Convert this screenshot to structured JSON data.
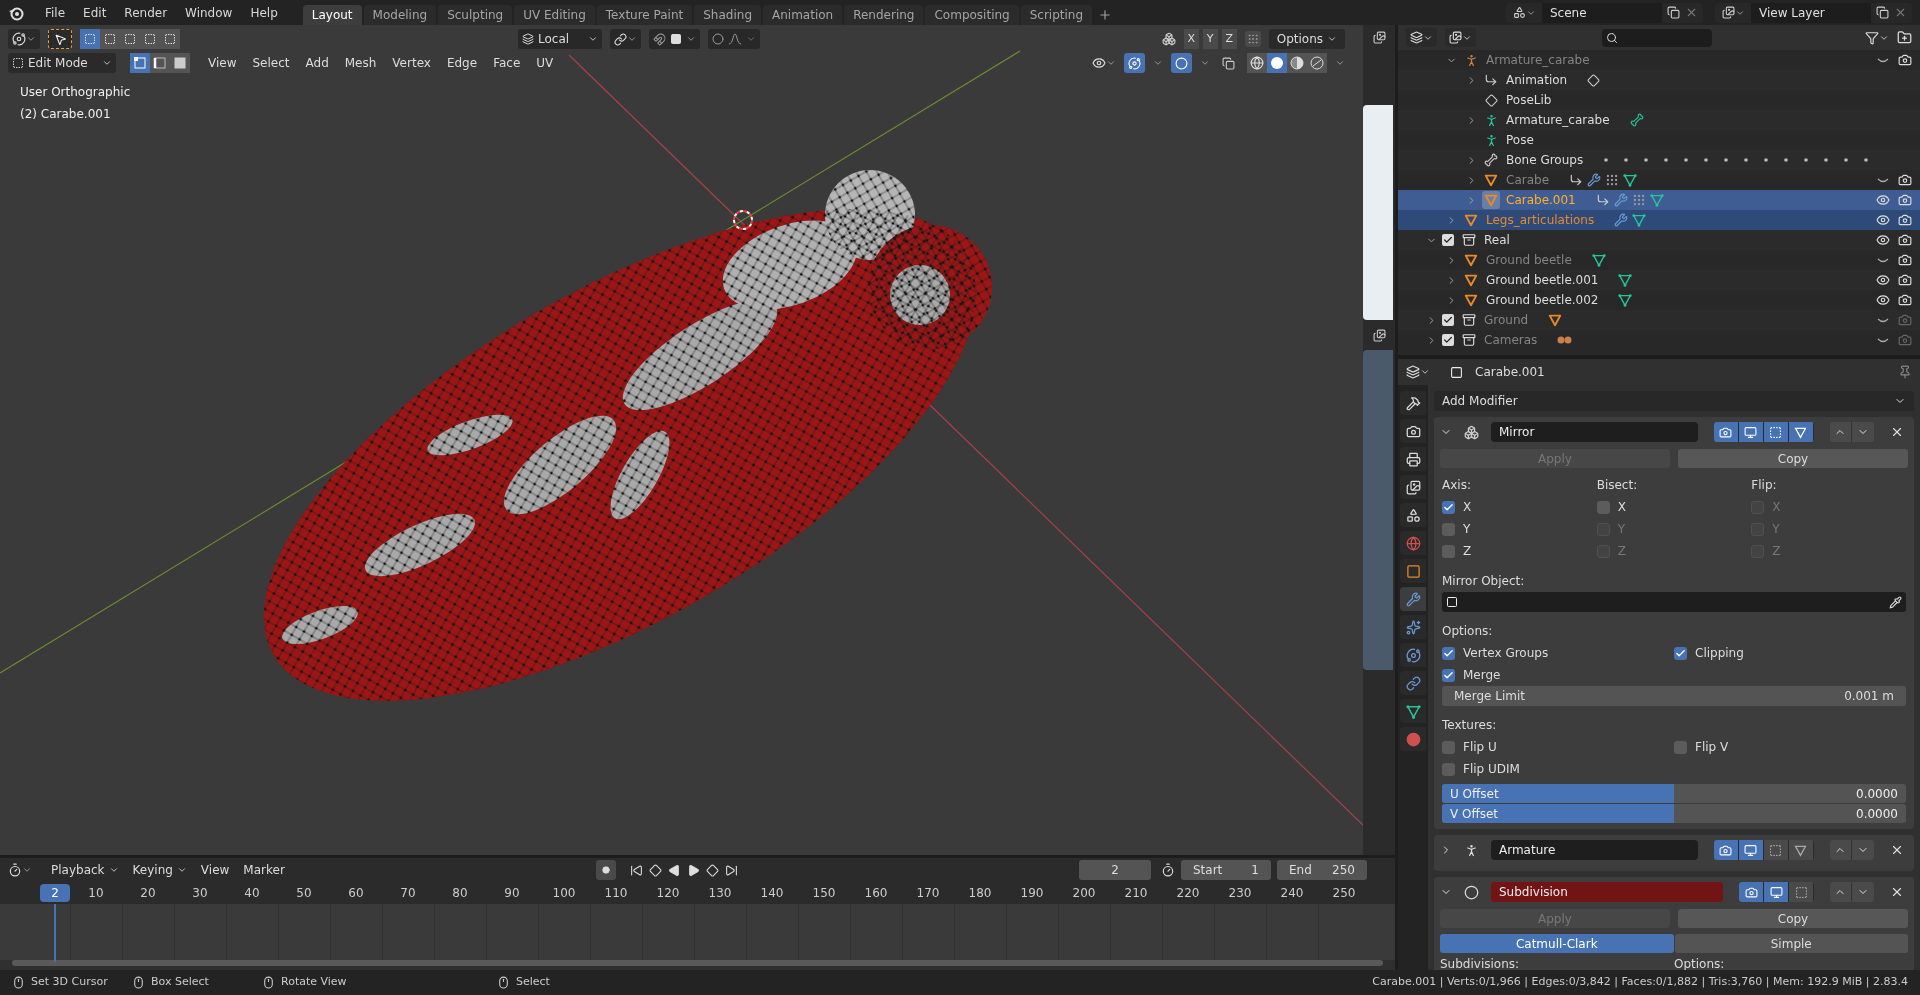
{
  "menu": [
    "File",
    "Edit",
    "Render",
    "Window",
    "Help"
  ],
  "workspaces": [
    {
      "label": "Layout",
      "selected": true
    },
    {
      "label": "Modeling",
      "selected": false
    },
    {
      "label": "Sculpting",
      "selected": false
    },
    {
      "label": "UV Editing",
      "selected": false
    },
    {
      "label": "Texture Paint",
      "selected": false
    },
    {
      "label": "Shading",
      "selected": false
    },
    {
      "label": "Animation",
      "selected": false
    },
    {
      "label": "Rendering",
      "selected": false
    },
    {
      "label": "Compositing",
      "selected": false
    },
    {
      "label": "Scripting",
      "selected": false
    }
  ],
  "scene": "Scene",
  "view_layer": "View Layer",
  "viewport": {
    "selection_ops": [
      {
        "selected": true
      },
      {
        "selected": false
      },
      {
        "selected": false
      },
      {
        "selected": false
      },
      {
        "selected": false
      }
    ],
    "orientation": "Local",
    "axis_toggles": [
      {
        "label": "X",
        "on": false
      },
      {
        "label": "Y",
        "on": false
      },
      {
        "label": "Z",
        "on": false
      }
    ],
    "options": "Options",
    "mode": "Edit Mode",
    "select_modes": [
      {
        "kind": "vertex",
        "selected": true
      },
      {
        "kind": "edge",
        "selected": false
      },
      {
        "kind": "face",
        "selected": false
      }
    ],
    "menus": [
      "View",
      "Select",
      "Add",
      "Mesh",
      "Vertex",
      "Edge",
      "Face",
      "UV"
    ],
    "shading": [
      {
        "kind": "wireframe",
        "selected": false
      },
      {
        "kind": "solid",
        "selected": true
      },
      {
        "kind": "material",
        "selected": false
      },
      {
        "kind": "rendered",
        "selected": false
      }
    ],
    "view_name": "User Orthographic",
    "object_label": "(2) Carabe.001"
  },
  "outliner": {
    "continued_items": [
      {
        "name": "Armature_carabe",
        "kind": "armature",
        "expanded": true,
        "dimmed": true,
        "selected": false,
        "active": false,
        "visible": false,
        "renderable": true,
        "children": [
          {
            "name": "Animation",
            "kind": "action",
            "expanded": false,
            "dimmed": false,
            "selected": false,
            "active": false,
            "badges": [
              {
                "kind": "poselib"
              }
            ]
          },
          {
            "name": "PoseLib",
            "kind": "poselib",
            "dimmed": false,
            "selected": false,
            "active": false
          },
          {
            "name": "Armature_carabe",
            "kind": "armature_data",
            "expanded": false,
            "dimmed": false,
            "selected": false,
            "active": false,
            "badges": [
              {
                "kind": "bone"
              }
            ]
          },
          {
            "name": "Pose",
            "kind": "pose",
            "dimmed": false,
            "selected": false,
            "active": false
          },
          {
            "name": "Bone Groups",
            "kind": "bone_groups",
            "expanded": false,
            "dimmed": false,
            "selected": false,
            "active": false,
            "badges": [
              {
                "kind": "dots"
              }
            ]
          },
          {
            "name": "Carabe",
            "kind": "mesh_object",
            "expanded": false,
            "dimmed": true,
            "selected": false,
            "active": false,
            "visible": false,
            "renderable": true,
            "badges": [
              {
                "kind": "action"
              },
              {
                "kind": "modifier"
              },
              {
                "kind": "particles"
              },
              {
                "kind": "mesh"
              }
            ]
          },
          {
            "name": "Carabe.001",
            "kind": "mesh_object",
            "expanded": false,
            "dimmed": false,
            "selected": true,
            "active": true,
            "visible": true,
            "renderable": true,
            "badges": [
              {
                "kind": "action"
              },
              {
                "kind": "modifier"
              },
              {
                "kind": "particles"
              },
              {
                "kind": "mesh"
              }
            ]
          }
        ]
      },
      {
        "name": "Legs_articulations",
        "kind": "mesh_object",
        "expanded": false,
        "dimmed": false,
        "selected": true,
        "active": false,
        "visible": true,
        "renderable": true,
        "badges": [
          {
            "kind": "modifier"
          },
          {
            "kind": "mesh"
          }
        ]
      }
    ],
    "items": [
      {
        "name": "Real",
        "kind": "collection",
        "expanded": true,
        "checked": true,
        "dimmed": false,
        "selected": false,
        "active": false,
        "visible": true,
        "renderable": true,
        "children": [
          {
            "name": "Ground beetle",
            "kind": "mesh_object",
            "expanded": false,
            "dimmed": true,
            "selected": false,
            "active": false,
            "visible": false,
            "renderable": true,
            "badges": [
              {
                "kind": "mesh"
              }
            ]
          },
          {
            "name": "Ground beetle.001",
            "kind": "mesh_object",
            "expanded": false,
            "dimmed": false,
            "selected": false,
            "active": false,
            "visible": true,
            "renderable": true,
            "badges": [
              {
                "kind": "mesh"
              }
            ]
          },
          {
            "name": "Ground beetle.002",
            "kind": "mesh_object",
            "expanded": false,
            "dimmed": false,
            "selected": false,
            "active": false,
            "visible": true,
            "renderable": true,
            "badges": [
              {
                "kind": "mesh"
              }
            ]
          }
        ]
      },
      {
        "name": "Ground",
        "kind": "collection",
        "expanded": false,
        "checked": true,
        "dimmed": true,
        "selected": false,
        "active": false,
        "visible": false,
        "renderable": false,
        "badges": [
          {
            "kind": "mesh_object"
          }
        ]
      },
      {
        "name": "Cameras",
        "kind": "collection",
        "expanded": false,
        "checked": true,
        "dimmed": true,
        "selected": false,
        "active": false,
        "visible": false,
        "renderable": false,
        "badges": [
          {
            "kind": "camera"
          }
        ]
      }
    ]
  },
  "properties": {
    "object": "Carabe.001",
    "tabs": [
      {
        "kind": "tool",
        "selected": false
      },
      {
        "kind": "render",
        "selected": false
      },
      {
        "kind": "output",
        "selected": false
      },
      {
        "kind": "view_layer",
        "selected": false
      },
      {
        "kind": "scene",
        "selected": false
      },
      {
        "kind": "world",
        "selected": false
      },
      {
        "kind": "object",
        "selected": false
      },
      {
        "kind": "modifiers",
        "selected": true
      },
      {
        "kind": "particles",
        "selected": false
      },
      {
        "kind": "physics",
        "selected": false
      },
      {
        "kind": "constraints",
        "selected": false
      },
      {
        "kind": "data",
        "selected": false
      },
      {
        "kind": "material",
        "selected": false
      }
    ],
    "add_modifier": "Add Modifier",
    "modifiers": [
      {
        "kind": "mirror",
        "name": "Mirror",
        "expanded": true,
        "warning": false,
        "toggles": [
          {
            "kind": "render",
            "on": true
          },
          {
            "kind": "viewport",
            "on": true
          },
          {
            "kind": "editmode",
            "on": true
          },
          {
            "kind": "cage",
            "on": true
          }
        ],
        "apply": {
          "label": "Apply",
          "disabled": true
        },
        "copy": {
          "label": "Copy",
          "disabled": false
        },
        "axis_groups": [
          {
            "label": "Axis:",
            "items": [
              {
                "label": "X",
                "checked": true,
                "disabled": false
              },
              {
                "label": "Y",
                "checked": false,
                "disabled": false
              },
              {
                "label": "Z",
                "checked": false,
                "disabled": false
              }
            ]
          },
          {
            "label": "Bisect:",
            "items": [
              {
                "label": "X",
                "checked": false,
                "disabled": false
              },
              {
                "label": "Y",
                "checked": false,
                "disabled": true
              },
              {
                "label": "Z",
                "checked": false,
                "disabled": true
              }
            ]
          },
          {
            "label": "Flip:",
            "items": [
              {
                "label": "X",
                "checked": false,
                "disabled": true
              },
              {
                "label": "Y",
                "checked": false,
                "disabled": true
              },
              {
                "label": "Z",
                "checked": false,
                "disabled": true
              }
            ]
          }
        ],
        "mirror_object_label": "Mirror Object:",
        "options_label": "Options:",
        "options": [
          {
            "label": "Vertex Groups",
            "checked": true
          },
          {
            "label": "Clipping",
            "checked": true
          },
          {
            "label": "Merge",
            "checked": true
          }
        ],
        "merge_limit": {
          "label": "Merge Limit",
          "value": "0.001 m"
        },
        "textures_label": "Textures:",
        "textures": [
          {
            "label": "Flip U",
            "checked": false
          },
          {
            "label": "Flip V",
            "checked": false
          },
          {
            "label": "Flip UDIM",
            "checked": false
          }
        ],
        "offsets": [
          {
            "label": "U Offset",
            "value": "0.0000",
            "level": 0.5
          },
          {
            "label": "V Offset",
            "value": "0.0000",
            "level": 0.5
          }
        ]
      },
      {
        "kind": "armature",
        "name": "Armature",
        "expanded": false,
        "warning": false,
        "toggles": [
          {
            "kind": "render",
            "on": true
          },
          {
            "kind": "viewport",
            "on": true
          },
          {
            "kind": "editmode",
            "on": false
          },
          {
            "kind": "cage",
            "on": false
          }
        ]
      },
      {
        "kind": "subdivision",
        "name": "Subdivision",
        "expanded": true,
        "warning": true,
        "toggles": [
          {
            "kind": "render",
            "on": true
          },
          {
            "kind": "viewport",
            "on": true
          },
          {
            "kind": "editmode",
            "on": false
          }
        ],
        "apply": {
          "label": "Apply",
          "disabled": true
        },
        "copy": {
          "label": "Copy",
          "disabled": false
        },
        "types": [
          {
            "label": "Catmull-Clark",
            "selected": true
          },
          {
            "label": "Simple",
            "selected": false
          }
        ],
        "subdivisions_label": "Subdivisions:",
        "options_label": "Options:"
      }
    ]
  },
  "timeline": {
    "menus": [
      {
        "label": "Playback",
        "dropdown": true
      },
      {
        "label": "Keying",
        "dropdown": true
      },
      {
        "label": "View",
        "dropdown": false
      },
      {
        "label": "Marker",
        "dropdown": false
      }
    ],
    "frame_field": "2",
    "start": {
      "label": "Start",
      "value": "1"
    },
    "end": {
      "label": "End",
      "value": "250"
    },
    "current_frame": "2",
    "frame_labels": [
      "10",
      "20",
      "30",
      "40",
      "50",
      "60",
      "70",
      "80",
      "90",
      "100",
      "110",
      "120",
      "130",
      "140",
      "150",
      "160",
      "170",
      "180",
      "190",
      "200",
      "210",
      "220",
      "230",
      "240",
      "250"
    ]
  },
  "status_bar": {
    "hints": [
      "Set 3D Cursor",
      "Box Select",
      "Rotate View",
      "Select"
    ],
    "stats": "Carabe.001 | Verts:0/1,966 | Edges:0/3,842 | Faces:0/1,882 | Tris:3,760 | Mem: 192.9 MiB | 2.83.4"
  }
}
